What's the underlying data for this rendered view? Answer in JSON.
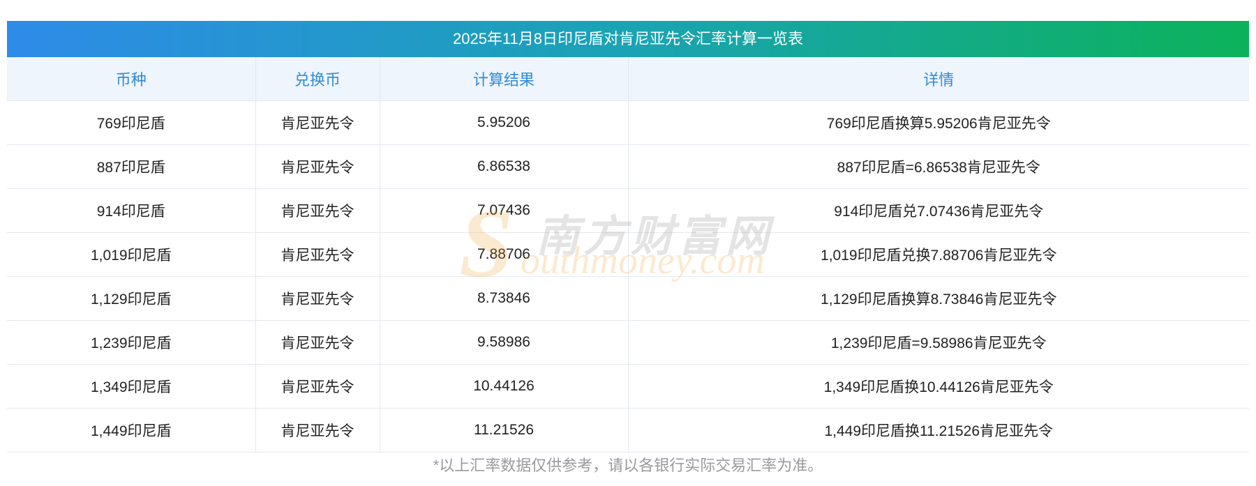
{
  "title": "2025年11月8日印尼盾对肯尼亚先令汇率计算一览表",
  "headers": [
    "币种",
    "兑换币",
    "计算结果",
    "详情"
  ],
  "rows": [
    [
      "769印尼盾",
      "肯尼亚先令",
      "5.95206",
      "769印尼盾换算5.95206肯尼亚先令"
    ],
    [
      "887印尼盾",
      "肯尼亚先令",
      "6.86538",
      "887印尼盾=6.86538肯尼亚先令"
    ],
    [
      "914印尼盾",
      "肯尼亚先令",
      "7.07436",
      "914印尼盾兑7.07436肯尼亚先令"
    ],
    [
      "1,019印尼盾",
      "肯尼亚先令",
      "7.88706",
      "1,019印尼盾兑换7.88706肯尼亚先令"
    ],
    [
      "1,129印尼盾",
      "肯尼亚先令",
      "8.73846",
      "1,129印尼盾换算8.73846肯尼亚先令"
    ],
    [
      "1,239印尼盾",
      "肯尼亚先令",
      "9.58986",
      "1,239印尼盾=9.58986肯尼亚先令"
    ],
    [
      "1,349印尼盾",
      "肯尼亚先令",
      "10.44126",
      "1,349印尼盾换10.44126肯尼亚先令"
    ],
    [
      "1,449印尼盾",
      "肯尼亚先令",
      "11.21526",
      "1,449印尼盾换11.21526肯尼亚先令"
    ]
  ],
  "watermark": {
    "cn": "南方财富网",
    "en_initial": "S",
    "en_rest": "outhmoney.com"
  },
  "footnote": "*以上汇率数据仅供参考，请以各银行实际交易汇率为准。",
  "colors": {
    "title_gradient_start": "#2e8be8",
    "title_gradient_end": "#0cb25a",
    "header_text": "#2f8bd8",
    "header_bg": "#eef5fd",
    "footnote_text": "#9a9a9a"
  }
}
